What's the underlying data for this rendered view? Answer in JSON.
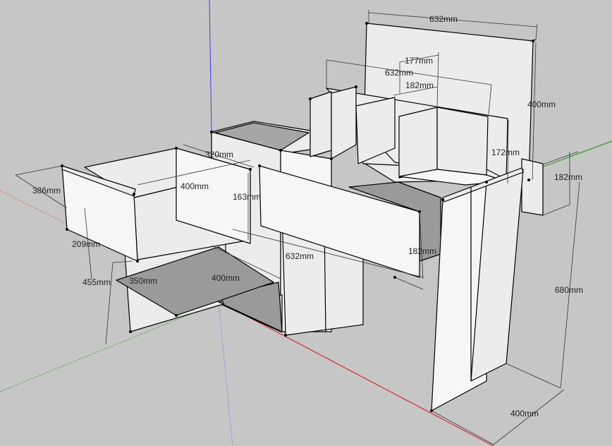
{
  "dimensions": {
    "top_width": "632mm",
    "divider_offset": "177mm",
    "middle_width": "632mm",
    "divider_width": "182mm",
    "back_height": "400mm",
    "cubby_height": "172mm",
    "side_depth": "182mm",
    "drawer_top_depth": "320mm",
    "drawer_depth": "386mm",
    "drawer_width": "400mm",
    "drawer_height": "163mm",
    "front_depth": "209mm",
    "shelf_height": "455mm",
    "shelf_depth": "350mm",
    "shelf_width": "400mm",
    "lower_width": "632mm",
    "front_panel_height": "182mm",
    "leg_height": "680mm",
    "leg_depth": "400mm"
  },
  "axes": {
    "blue": "#3a3aff",
    "red": "#e04040",
    "green": "#2a9a2a"
  }
}
